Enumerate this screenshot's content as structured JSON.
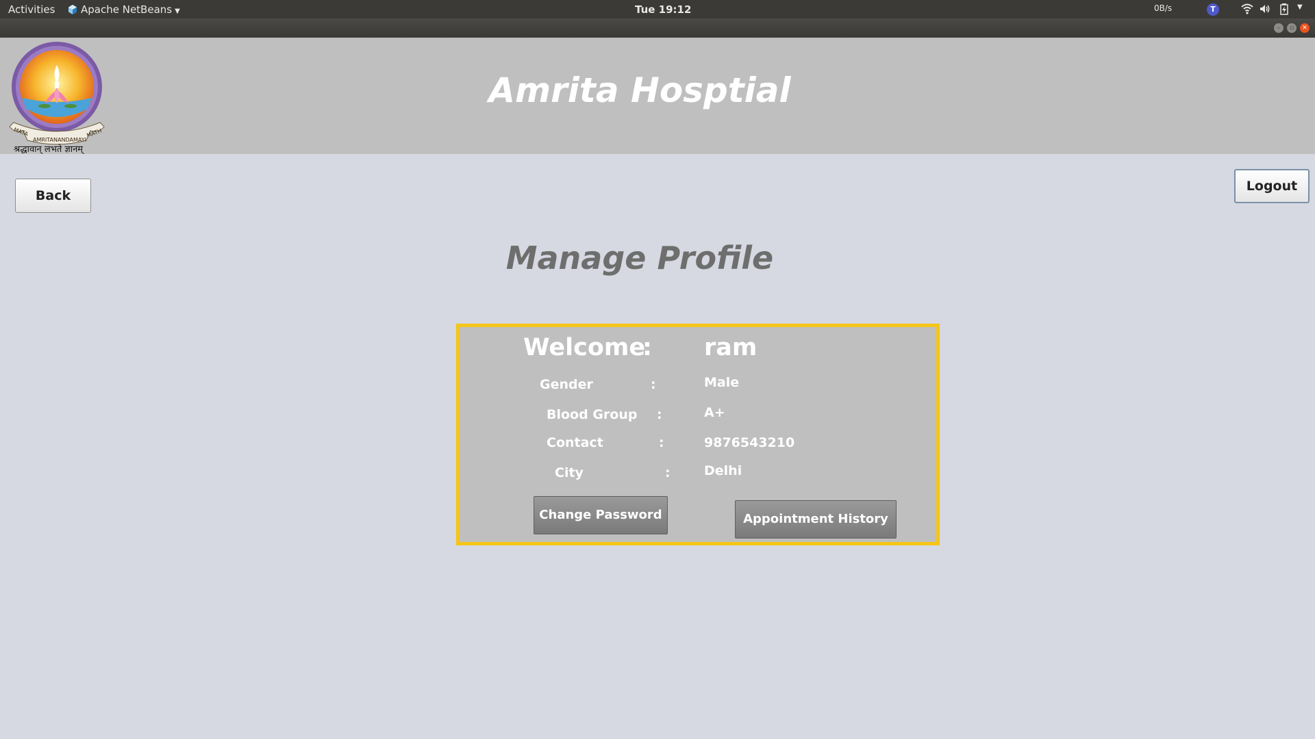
{
  "system_bar": {
    "activities": "Activities",
    "app_name": "Apache NetBeans",
    "clock": "Tue 19:12",
    "net_speed": "0B/s"
  },
  "header": {
    "title": "Amrita Hosptial",
    "logo_text": {
      "left_scroll": "MATA",
      "center_scroll": "AMRITANANDAMAYI",
      "right_scroll": "MATH",
      "motto": "श्रद्धावान् लभते ज्ञानम्"
    }
  },
  "nav": {
    "back_label": "Back",
    "logout_label": "Logout"
  },
  "page": {
    "title": "Manage Profile"
  },
  "profile": {
    "welcome_label": "Welcome",
    "welcome_value": "ram",
    "colon": ":",
    "fields": [
      {
        "label": "Gender",
        "value": "Male"
      },
      {
        "label": "Blood Group",
        "value": "A+"
      },
      {
        "label": "Contact",
        "value": "9876543210"
      },
      {
        "label": "City",
        "value": "Delhi"
      }
    ],
    "change_password_label": "Change Password",
    "appointment_history_label": "Appointment History"
  },
  "colors": {
    "panel_border": "#f5c518",
    "background": "#d6d9e1",
    "header_bg": "#bfbfbf"
  }
}
